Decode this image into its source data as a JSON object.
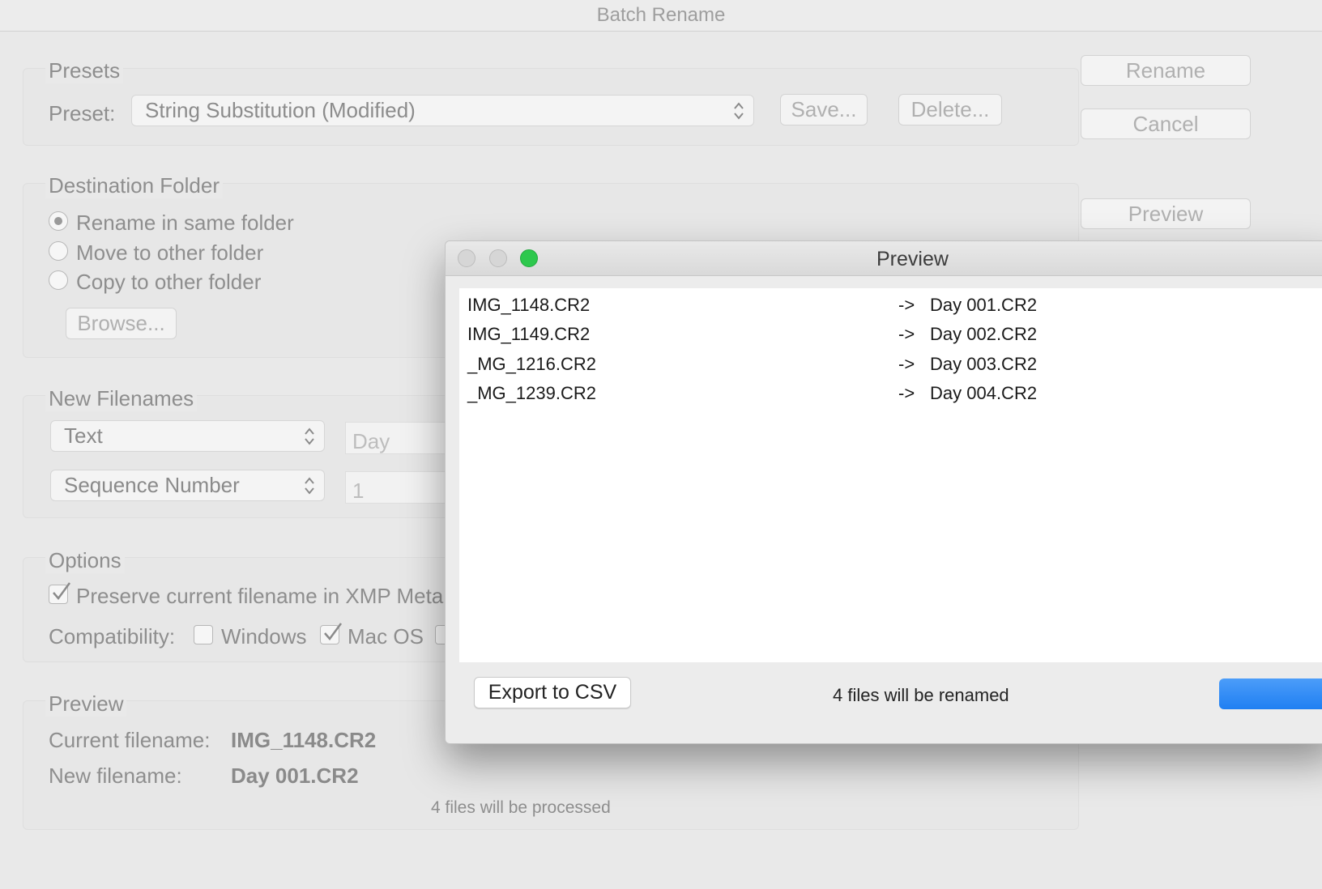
{
  "window": {
    "title": "Batch Rename"
  },
  "buttons": {
    "rename": "Rename",
    "cancel": "Cancel",
    "preview": "Preview"
  },
  "presets": {
    "legend": "Presets",
    "label": "Preset:",
    "selected": "String Substitution (Modified)",
    "save": "Save...",
    "delete": "Delete..."
  },
  "destination": {
    "legend": "Destination Folder",
    "options": [
      "Rename in same folder",
      "Move to other folder",
      "Copy to other folder"
    ],
    "selected_index": 0,
    "browse": "Browse..."
  },
  "new_filenames": {
    "legend": "New Filenames",
    "rows": [
      {
        "type": "Text",
        "value": "Day"
      },
      {
        "type": "Sequence Number",
        "value": "1"
      }
    ]
  },
  "options": {
    "legend": "Options",
    "preserve_label": "Preserve current filename in XMP Meta",
    "preserve_checked": true,
    "compat_label": "Compatibility:",
    "windows_label": "Windows",
    "windows_checked": false,
    "macos_label": "Mac OS",
    "macos_checked": true
  },
  "preview_section": {
    "legend": "Preview",
    "current_label": "Current filename:",
    "current_value": "IMG_1148.CR2",
    "new_label": "New filename:",
    "new_value": "Day 001.CR2",
    "processed": "4 files will be processed"
  },
  "dialog": {
    "title": "Preview",
    "arrow": "->",
    "files": [
      {
        "old": "IMG_1148.CR2",
        "new": "Day 001.CR2"
      },
      {
        "old": "IMG_1149.CR2",
        "new": "Day 002.CR2"
      },
      {
        "old": "_MG_1216.CR2",
        "new": "Day 003.CR2"
      },
      {
        "old": "_MG_1239.CR2",
        "new": "Day 004.CR2"
      }
    ],
    "export_label": "Export to CSV",
    "status": "4 files will be renamed"
  },
  "colors": {
    "accent": "#2c86f5",
    "zoom_green": "#2dc84d"
  }
}
